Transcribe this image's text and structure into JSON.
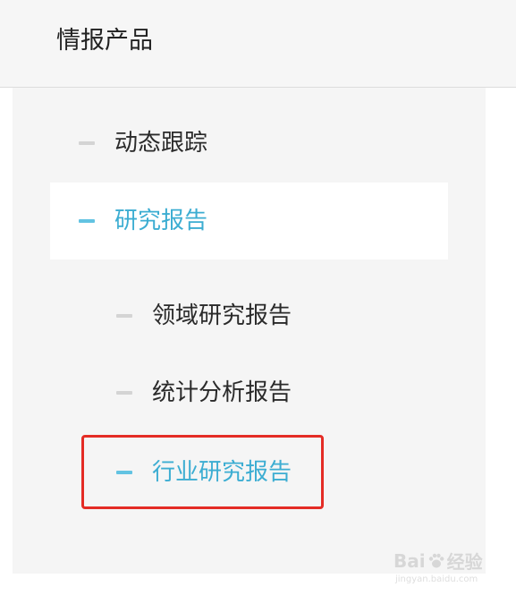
{
  "header": {
    "title": "情报产品"
  },
  "menu": {
    "items": [
      {
        "label": "动态跟踪",
        "active": false
      },
      {
        "label": "研究报告",
        "active": true
      },
      {
        "label": "领域研究报告",
        "active": false
      },
      {
        "label": "统计分析报告",
        "active": false
      },
      {
        "label": "行业研究报告",
        "active": true,
        "highlighted": true
      }
    ]
  },
  "colors": {
    "accent": "#3cadd2",
    "accent_dash": "#62c3e2",
    "inactive_dash": "#d4d4d4",
    "highlight_border": "#e42c25",
    "panel_bg": "#f5f5f5",
    "header_bg": "#f6f6f6"
  },
  "watermark": {
    "logo_left": "Bai",
    "logo_right": "经验",
    "url": "jingyan.baidu.com"
  }
}
